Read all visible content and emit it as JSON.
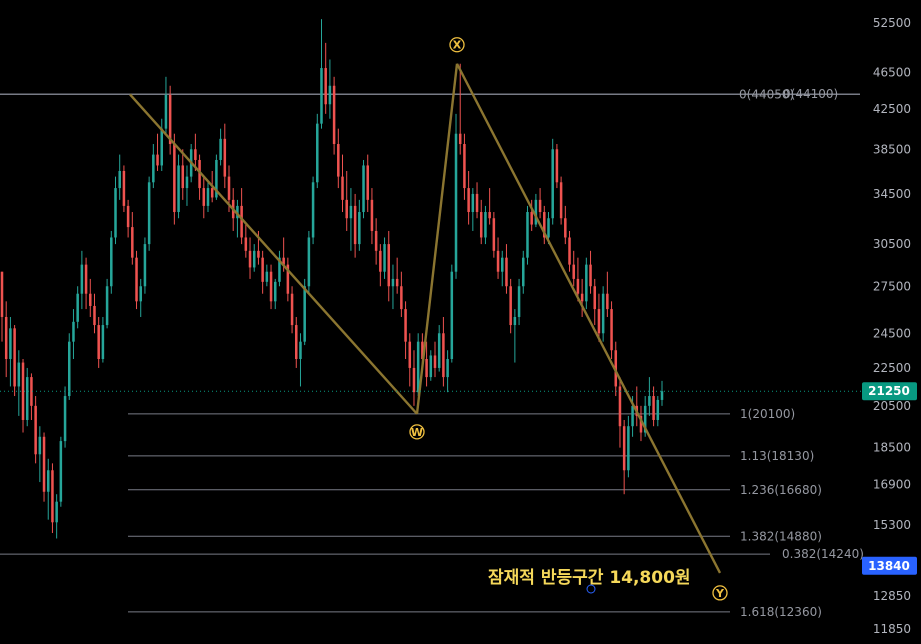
{
  "chart_data": {
    "type": "candlestick",
    "title": "",
    "xlabel": "",
    "ylabel": "",
    "scale": "log",
    "ylim": [
      11500,
      56000
    ],
    "grid": false,
    "y_ticks": [
      {
        "value": 52500,
        "label": "52500"
      },
      {
        "value": 46500,
        "label": "46500"
      },
      {
        "value": 42500,
        "label": "42500"
      },
      {
        "value": 38500,
        "label": "38500"
      },
      {
        "value": 34500,
        "label": "34500"
      },
      {
        "value": 30500,
        "label": "30500"
      },
      {
        "value": 27500,
        "label": "27500"
      },
      {
        "value": 24500,
        "label": "24500"
      },
      {
        "value": 22500,
        "label": "22500"
      },
      {
        "value": 20500,
        "label": "20500"
      },
      {
        "value": 18500,
        "label": "18500"
      },
      {
        "value": 16900,
        "label": "16900"
      },
      {
        "value": 15300,
        "label": "15300"
      },
      {
        "value": 12850,
        "label": "12850"
      },
      {
        "value": 11850,
        "label": "11850"
      }
    ],
    "price_labels": [
      {
        "value": 21250,
        "label": "21250",
        "color": "#089981",
        "style": "dotted"
      },
      {
        "value": 13840,
        "label": "13840",
        "color": "#2962ff",
        "style": "none"
      }
    ],
    "fib_levels": [
      {
        "ratio": "0",
        "price": 44050,
        "label": "0(44050)",
        "extended": true
      },
      {
        "ratio": "0",
        "price": 44100,
        "label": "0(44100)",
        "extended": true
      },
      {
        "ratio": "1",
        "price": 20100,
        "label": "1(20100)",
        "extended": false
      },
      {
        "ratio": "1.13",
        "price": 18130,
        "label": "1.13(18130)",
        "extended": false
      },
      {
        "ratio": "1.236",
        "price": 16680,
        "label": "1.236(16680)",
        "extended": false
      },
      {
        "ratio": "1.382",
        "price": 14880,
        "label": "1.382(14880)",
        "extended": false
      },
      {
        "ratio": "0.382",
        "price": 14240,
        "label": "0.382(14240)",
        "extended": true
      },
      {
        "ratio": "1.618",
        "price": 12360,
        "label": "1.618(12360)",
        "extended": false
      }
    ],
    "wave_points": [
      {
        "label": "",
        "bar": 130,
        "price": 44050
      },
      {
        "label": "W",
        "bar": 417,
        "price": 20100
      },
      {
        "label": "X",
        "bar": 457,
        "price": 47500
      },
      {
        "label": "Y",
        "bar": 720,
        "price": 13600
      }
    ],
    "annotation": "잠재적 반등구간 14,800원",
    "colors": {
      "up": "#26a69a",
      "down": "#ef5350",
      "wave_line": "#8b7530",
      "fib_line": "#787b86",
      "wave_label": "#f0c040",
      "annotation": "#f5d85a",
      "background": "#000000"
    },
    "ohlc": [
      [
        28500,
        28500,
        24000,
        25500
      ],
      [
        25500,
        26500,
        22000,
        23000
      ],
      [
        23000,
        25500,
        21500,
        24800
      ],
      [
        24800,
        25000,
        21000,
        21500
      ],
      [
        21500,
        23500,
        20000,
        22800
      ],
      [
        22800,
        23000,
        19200,
        19800
      ],
      [
        19800,
        22500,
        19500,
        22000
      ],
      [
        22000,
        22200,
        19800,
        20500
      ],
      [
        20500,
        21000,
        17800,
        18200
      ],
      [
        18200,
        19500,
        17000,
        19000
      ],
      [
        19000,
        19200,
        16200,
        16600
      ],
      [
        16600,
        18000,
        15500,
        17500
      ],
      [
        17500,
        17800,
        15000,
        15400
      ],
      [
        15400,
        16500,
        14800,
        16200
      ],
      [
        16200,
        19000,
        16000,
        18800
      ],
      [
        18800,
        21500,
        18500,
        21000
      ],
      [
        21000,
        24500,
        20800,
        24000
      ],
      [
        24000,
        26000,
        23000,
        25200
      ],
      [
        25200,
        27500,
        24800,
        27000
      ],
      [
        27000,
        30000,
        26000,
        29000
      ],
      [
        29000,
        29500,
        26000,
        27000
      ],
      [
        27000,
        28000,
        25500,
        26200
      ],
      [
        26200,
        27000,
        24500,
        25000
      ],
      [
        25000,
        25500,
        22500,
        23000
      ],
      [
        23000,
        25500,
        22800,
        25000
      ],
      [
        25000,
        28000,
        24800,
        27500
      ],
      [
        27500,
        31500,
        27000,
        31000
      ],
      [
        31000,
        36000,
        30500,
        35000
      ],
      [
        35000,
        38000,
        34000,
        36500
      ],
      [
        36500,
        37000,
        33000,
        33500
      ],
      [
        33500,
        34000,
        31000,
        31800
      ],
      [
        31800,
        33000,
        29000,
        29500
      ],
      [
        29500,
        30000,
        26000,
        26500
      ],
      [
        26500,
        28000,
        25500,
        27500
      ],
      [
        27500,
        31000,
        27000,
        30500
      ],
      [
        30500,
        36000,
        30000,
        35500
      ],
      [
        35500,
        39000,
        35000,
        38000
      ],
      [
        38000,
        40000,
        36500,
        37000
      ],
      [
        37000,
        41500,
        36500,
        40500
      ],
      [
        40500,
        46000,
        40000,
        44000
      ],
      [
        44000,
        45000,
        38000,
        39000
      ],
      [
        39000,
        40000,
        32000,
        33000
      ],
      [
        33000,
        38000,
        32500,
        37000
      ],
      [
        37000,
        38500,
        34000,
        35000
      ],
      [
        35000,
        37000,
        33500,
        36000
      ],
      [
        36000,
        39000,
        35500,
        38500
      ],
      [
        38500,
        40000,
        36500,
        37500
      ],
      [
        37500,
        38000,
        34000,
        35000
      ],
      [
        35000,
        36000,
        32500,
        33500
      ],
      [
        33500,
        35500,
        33000,
        35000
      ],
      [
        35000,
        36500,
        33800,
        34200
      ],
      [
        34200,
        38000,
        34000,
        37500
      ],
      [
        37500,
        40500,
        37000,
        39500
      ],
      [
        39500,
        41000,
        35000,
        36000
      ],
      [
        36000,
        37000,
        33000,
        34000
      ],
      [
        34000,
        35000,
        31500,
        32500
      ],
      [
        32500,
        34000,
        31000,
        33500
      ],
      [
        33500,
        35000,
        30500,
        31000
      ],
      [
        31000,
        32000,
        29500,
        30000
      ],
      [
        30000,
        31000,
        28000,
        28800
      ],
      [
        28800,
        30500,
        28500,
        30000
      ],
      [
        30000,
        31500,
        29000,
        29500
      ],
      [
        29500,
        30000,
        27000,
        27800
      ],
      [
        27800,
        29000,
        27500,
        28500
      ],
      [
        28500,
        29000,
        26000,
        26500
      ],
      [
        26500,
        28000,
        26000,
        27800
      ],
      [
        27800,
        30000,
        27500,
        29500
      ],
      [
        29500,
        31000,
        28500,
        29000
      ],
      [
        29000,
        29500,
        26500,
        27000
      ],
      [
        27000,
        27500,
        24500,
        25000
      ],
      [
        25000,
        25500,
        22500,
        23000
      ],
      [
        23000,
        24500,
        21500,
        24000
      ],
      [
        24000,
        28000,
        23800,
        27500
      ],
      [
        27500,
        31500,
        27000,
        31000
      ],
      [
        31000,
        36000,
        30500,
        35500
      ],
      [
        35500,
        42000,
        35000,
        41000
      ],
      [
        41000,
        53000,
        40500,
        47000
      ],
      [
        47000,
        50000,
        42000,
        43000
      ],
      [
        43000,
        48000,
        41500,
        45000
      ],
      [
        45000,
        46000,
        38000,
        39000
      ],
      [
        39000,
        40500,
        35000,
        36000
      ],
      [
        36000,
        38000,
        33000,
        34000
      ],
      [
        34000,
        36500,
        31500,
        32500
      ],
      [
        32500,
        35000,
        30000,
        33500
      ],
      [
        33500,
        34500,
        29500,
        30500
      ],
      [
        30500,
        34000,
        30000,
        33000
      ],
      [
        33000,
        37500,
        32500,
        37000
      ],
      [
        37000,
        38000,
        33000,
        34000
      ],
      [
        34000,
        35000,
        30500,
        31500
      ],
      [
        31500,
        32500,
        29000,
        30000
      ],
      [
        30000,
        30500,
        27500,
        28500
      ],
      [
        28500,
        31000,
        28000,
        30500
      ],
      [
        30500,
        31500,
        26500,
        27500
      ],
      [
        27500,
        29000,
        26000,
        28000
      ],
      [
        28000,
        29500,
        27000,
        27500
      ],
      [
        27500,
        28500,
        25500,
        26000
      ],
      [
        26000,
        26500,
        23000,
        24000
      ],
      [
        24000,
        24500,
        21500,
        22500
      ],
      [
        22500,
        23500,
        20500,
        21200
      ],
      [
        21200,
        24500,
        21000,
        24000
      ],
      [
        24000,
        24500,
        22500,
        23000
      ],
      [
        23000,
        24000,
        21500,
        22000
      ],
      [
        22000,
        23500,
        21800,
        23200
      ],
      [
        23200,
        24000,
        22000,
        22500
      ],
      [
        22500,
        25000,
        22300,
        24500
      ],
      [
        24500,
        25500,
        21500,
        22000
      ],
      [
        22000,
        23500,
        21200,
        23000
      ],
      [
        23000,
        29000,
        22800,
        28500
      ],
      [
        28500,
        42000,
        28000,
        40000
      ],
      [
        40000,
        47500,
        38000,
        39000
      ],
      [
        39000,
        40000,
        34000,
        35000
      ],
      [
        35000,
        36500,
        32000,
        33000
      ],
      [
        33000,
        35000,
        31500,
        34500
      ],
      [
        34500,
        35500,
        32500,
        33000
      ],
      [
        33000,
        34000,
        30500,
        31000
      ],
      [
        31000,
        33500,
        30500,
        33000
      ],
      [
        33000,
        35000,
        32000,
        32500
      ],
      [
        32500,
        33000,
        29500,
        30000
      ],
      [
        30000,
        31000,
        28000,
        28500
      ],
      [
        28500,
        30000,
        27500,
        29500
      ],
      [
        29500,
        30500,
        27000,
        27500
      ],
      [
        27500,
        28000,
        24500,
        25000
      ],
      [
        25000,
        26000,
        22800,
        25500
      ],
      [
        25500,
        28000,
        25000,
        27500
      ],
      [
        27500,
        30000,
        27000,
        29500
      ],
      [
        29500,
        33500,
        29000,
        33000
      ],
      [
        33000,
        34000,
        31500,
        32000
      ],
      [
        32000,
        34500,
        31800,
        34000
      ],
      [
        34000,
        35000,
        32500,
        33000
      ],
      [
        33000,
        33500,
        30500,
        31000
      ],
      [
        31000,
        33000,
        30500,
        32500
      ],
      [
        32500,
        39500,
        32000,
        38500
      ],
      [
        38500,
        39000,
        35000,
        35500
      ],
      [
        35500,
        36000,
        32000,
        32500
      ],
      [
        32500,
        33500,
        30500,
        31000
      ],
      [
        31000,
        31500,
        28500,
        29000
      ],
      [
        29000,
        30000,
        27500,
        28000
      ],
      [
        28000,
        29500,
        26500,
        27000
      ],
      [
        27000,
        28000,
        25500,
        26500
      ],
      [
        26500,
        29500,
        26000,
        29000
      ],
      [
        29000,
        30000,
        27000,
        27500
      ],
      [
        27500,
        28000,
        25000,
        26000
      ],
      [
        26000,
        27000,
        24000,
        24500
      ],
      [
        24500,
        27500,
        24000,
        27000
      ],
      [
        27000,
        28500,
        25500,
        26000
      ],
      [
        26000,
        26500,
        23000,
        23500
      ],
      [
        23500,
        24000,
        21000,
        21500
      ],
      [
        21500,
        22000,
        18500,
        19500
      ],
      [
        19500,
        19800,
        16500,
        17500
      ],
      [
        17500,
        20000,
        17200,
        19500
      ],
      [
        19500,
        21000,
        19000,
        20500
      ],
      [
        20500,
        21500,
        19500,
        20000
      ],
      [
        20000,
        20500,
        18800,
        19200
      ],
      [
        19200,
        21000,
        19000,
        20500
      ],
      [
        20500,
        22000,
        20000,
        21000
      ],
      [
        21000,
        21500,
        19500,
        19800
      ],
      [
        19800,
        21000,
        19500,
        20800
      ],
      [
        20800,
        21800,
        20500,
        21250
      ]
    ]
  }
}
